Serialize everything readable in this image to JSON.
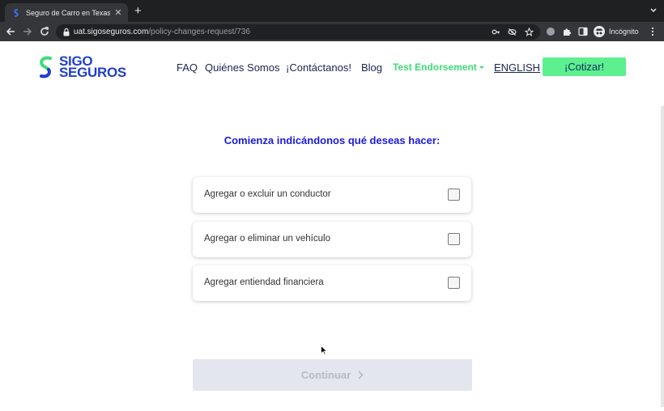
{
  "browser": {
    "tab": {
      "title": "Seguro de Carro en Texas - Sigo"
    },
    "address": {
      "host": "uat.sigoseguros.com",
      "path": "/policy-changes-request/736"
    },
    "profile": {
      "label": "Incógnito"
    }
  },
  "site": {
    "logo": {
      "line1": "SIGO",
      "line2": "SEGUROS"
    },
    "nav": {
      "faq": "FAQ",
      "about": "Quiénes Somos",
      "contact": "¡Contáctanos!",
      "blog": "Blog",
      "test_endorsement": "Test Endorsement",
      "language": "ENGLISH"
    },
    "cta_label": "¡Cotizar!"
  },
  "form": {
    "heading": "Comienza indicándonos qué deseas hacer:",
    "options": [
      {
        "label": "Agregar o excluir un conductor",
        "checked": false
      },
      {
        "label": "Agregar o eliminar un vehículo",
        "checked": false
      },
      {
        "label": "Agregar entiendad financiera",
        "checked": false
      }
    ],
    "continue_label": "Continuar"
  },
  "colors": {
    "brand_blue": "#1f3fcc",
    "heading_blue": "#1a1ad8",
    "accent_green": "#5cf08f",
    "nav_text": "#1a2450",
    "disabled_button": "#e3e6ee"
  }
}
